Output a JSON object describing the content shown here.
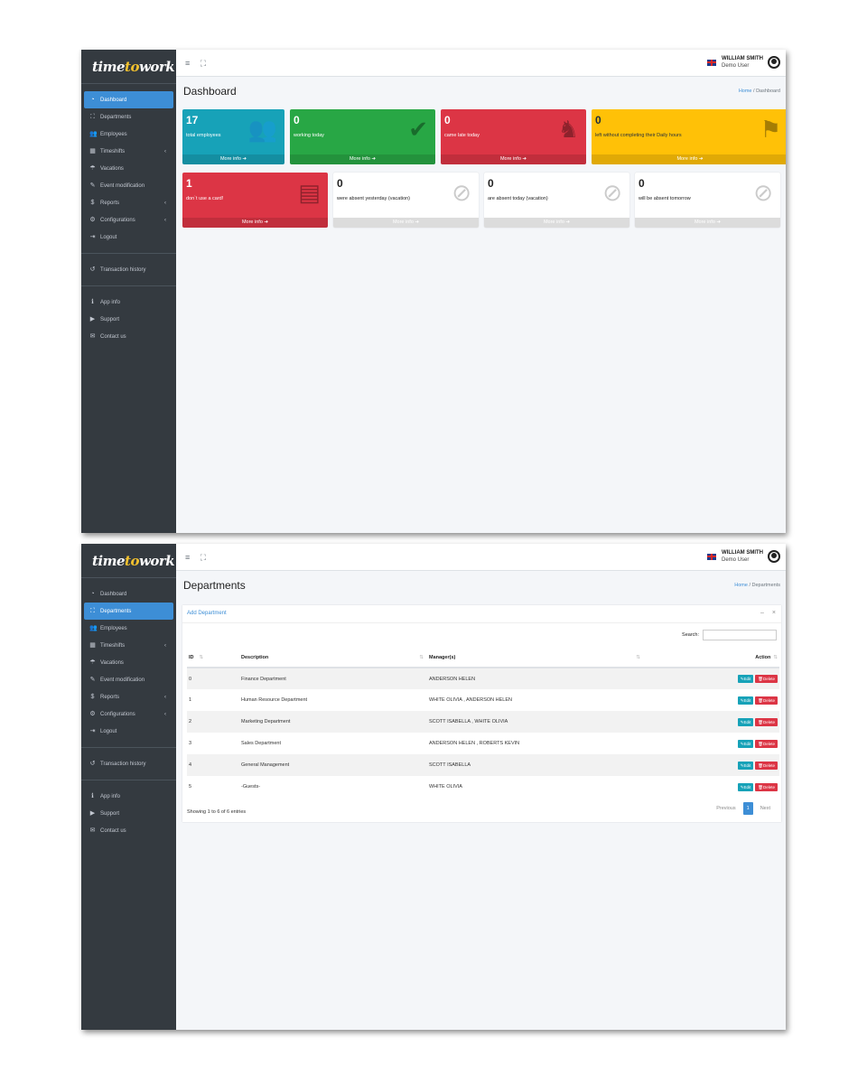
{
  "brand": {
    "part1": "time",
    "part2": "to",
    "part3": "work"
  },
  "user": {
    "name": "WILLIAM SMITH",
    "role": "Demo User"
  },
  "topbar_icons": [
    "menu-icon",
    "fullscreen-icon"
  ],
  "sidebar": {
    "items": [
      {
        "label": "Dashboard",
        "icon": "dashboard-icon"
      },
      {
        "label": "Departments",
        "icon": "sitemap-icon"
      },
      {
        "label": "Employees",
        "icon": "users-icon"
      },
      {
        "label": "Timeshifts",
        "icon": "calendar-icon",
        "arrow": "‹"
      },
      {
        "label": "Vacations",
        "icon": "umbrella-beach-icon"
      },
      {
        "label": "Event modification",
        "icon": "edit-icon"
      },
      {
        "label": "Reports",
        "icon": "reports-icon",
        "arrow": "‹"
      },
      {
        "label": "Configurations",
        "icon": "cogs-icon",
        "arrow": "‹"
      },
      {
        "label": "Logout",
        "icon": "logout-icon"
      }
    ],
    "history": {
      "label": "Transaction history",
      "icon": "history-icon"
    },
    "extra": [
      {
        "label": "App info",
        "icon": "info-icon"
      },
      {
        "label": "Support",
        "icon": "play-icon"
      },
      {
        "label": "Contact us",
        "icon": "envelope-icon"
      }
    ]
  },
  "dashboard": {
    "title": "Dashboard",
    "breadcrumb": {
      "home": "Home",
      "sep": "/",
      "current": "Dashboard"
    },
    "boxes": [
      {
        "number": "17",
        "text": "total employees",
        "more": "More info ➔",
        "color": "#17a2b8",
        "icon": "users-icon"
      },
      {
        "number": "0",
        "text": "working today",
        "more": "More info ➔",
        "color": "#28a745",
        "icon": "user-check-icon"
      },
      {
        "number": "0",
        "text": "came late today",
        "more": "More info ➔",
        "color": "#dc3545",
        "icon": "walking-icon"
      },
      {
        "number": "0",
        "text": "left without completing their Daily hours",
        "more": "More info ➔",
        "color": "#ffc107",
        "icon": "running-icon"
      },
      {
        "number": "1",
        "text": "don`t use a card!",
        "more": "More info ➔",
        "color": "#dc3545",
        "icon": "id-card-icon"
      },
      {
        "number": "0",
        "text": "were absent yesterday (vacation)",
        "more": "More info ➔",
        "color": "#ffffff",
        "icon": "user-slash-icon"
      },
      {
        "number": "0",
        "text": "are absent today (vacation)",
        "more": "More info ➔",
        "color": "#ffffff",
        "icon": "user-slash-icon"
      },
      {
        "number": "0",
        "text": "will be absent tomorrow",
        "more": "More info ➔",
        "color": "#ffffff",
        "icon": "user-slash-icon"
      }
    ]
  },
  "departments": {
    "title": "Departments",
    "breadcrumb": {
      "home": "Home",
      "sep": "/",
      "current": "Departments"
    },
    "add_label": "Add Department",
    "search_label": "Search:",
    "columns": [
      "ID",
      "Description",
      "Manager(s)",
      "Action"
    ],
    "rows": [
      {
        "id": "0",
        "description": "Finance Department",
        "managers": "ANDERSON HELEN"
      },
      {
        "id": "1",
        "description": "Human Resource Department",
        "managers": "WHITE OLIVIA , ANDERSON HELEN"
      },
      {
        "id": "2",
        "description": "Marketing Department",
        "managers": "SCOTT ISABELLA , WHITE OLIVIA"
      },
      {
        "id": "3",
        "description": "Sales Department",
        "managers": "ANDERSON HELEN , ROBERTS KEVIN"
      },
      {
        "id": "4",
        "description": "General Management",
        "managers": "SCOTT ISABELLA"
      },
      {
        "id": "5",
        "description": "-Guests-",
        "managers": "WHITE OLIVIA"
      }
    ],
    "edit_label": "✎Edit",
    "delete_label": "🗑Delete",
    "info": "Showing 1 to 6 of 6 entries",
    "pager": {
      "prev": "Previous",
      "page": "1",
      "next": "Next"
    }
  }
}
